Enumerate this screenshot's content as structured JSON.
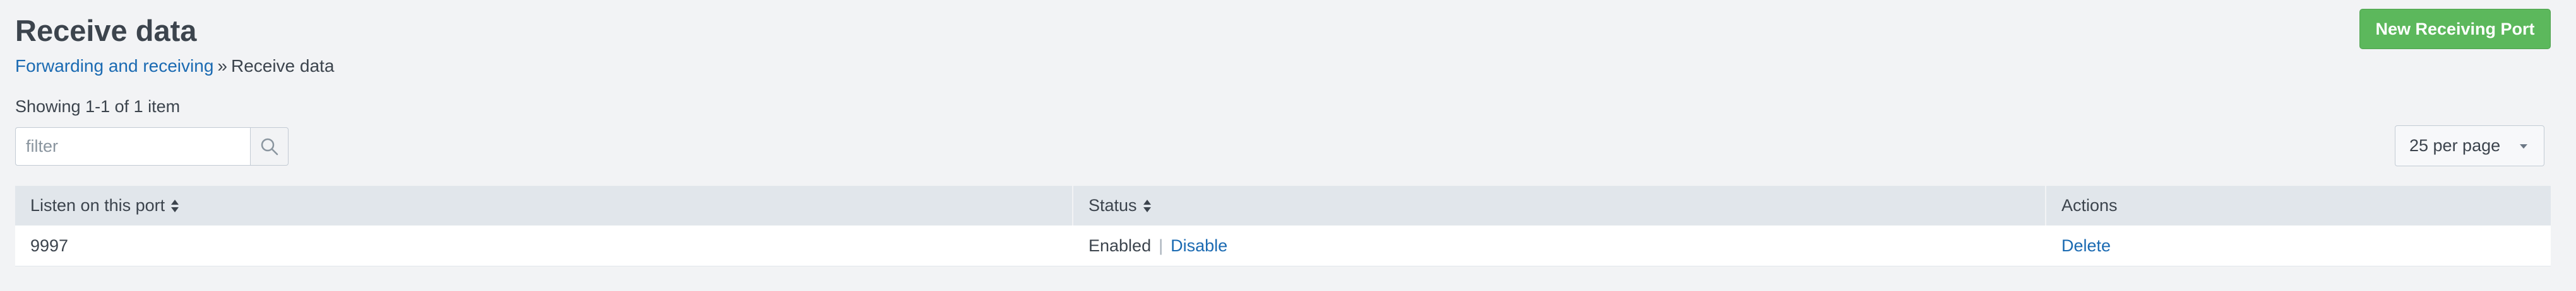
{
  "header": {
    "title": "Receive data",
    "new_button_label": "New Receiving Port"
  },
  "breadcrumb": {
    "parent": "Forwarding and receiving",
    "separator": "»",
    "current": "Receive data"
  },
  "listing": {
    "count_text": "Showing 1-1 of 1 item",
    "filter_placeholder": "filter",
    "filter_value": "",
    "per_page": "25 per page"
  },
  "table": {
    "headers": {
      "port": "Listen on this port",
      "status": "Status",
      "actions": "Actions"
    },
    "rows": [
      {
        "port": "9997",
        "status": "Enabled",
        "status_separator": "|",
        "toggle_action": "Disable",
        "delete_action": "Delete"
      }
    ]
  },
  "colors": {
    "primary_button": "#5cb85c",
    "link": "#1a6ab2",
    "header_bg": "#e1e6eb",
    "page_bg": "#f2f3f5"
  },
  "icons": {
    "search": "search-icon",
    "sort": "sort-icon",
    "caret": "caret-down-icon"
  }
}
